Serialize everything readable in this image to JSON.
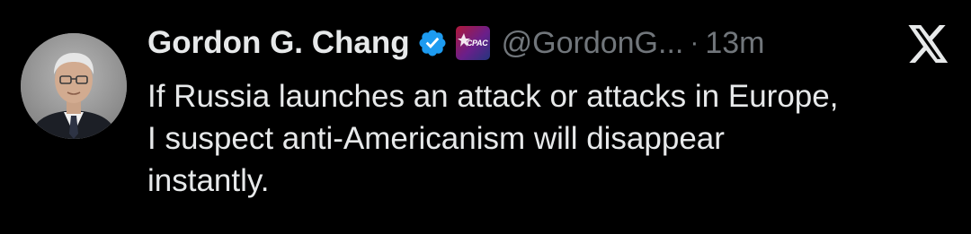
{
  "author": {
    "display_name": "Gordon G. Chang",
    "handle": "@GordonG...",
    "verified": true,
    "affiliate_badge_text": "CPAC",
    "avatar": "avatar-photo"
  },
  "meta": {
    "separator": "·",
    "timestamp": "13m"
  },
  "tweet": {
    "lines": [
      "If Russia launches an attack or attacks in Europe,",
      "I suspect anti-Americanism will disappear",
      "instantly."
    ]
  },
  "icons": {
    "verified": "verified-badge-icon",
    "affiliate": "cpac-affiliate-icon",
    "platform": "x-logo-icon"
  },
  "colors": {
    "background": "#000000",
    "text": "#e7e9ea",
    "secondary": "#71767b",
    "verified_blue": "#1d9bf0"
  }
}
